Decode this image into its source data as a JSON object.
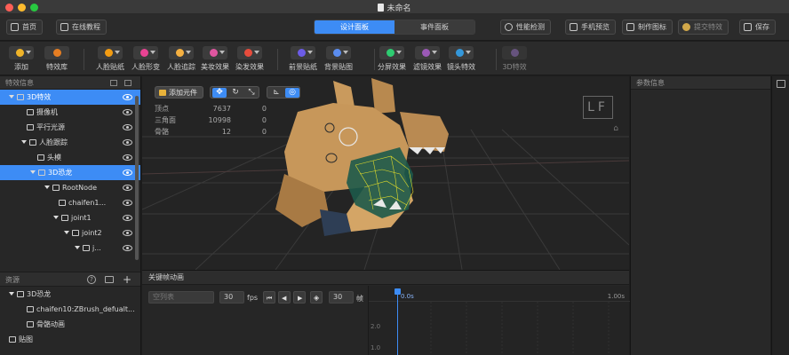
{
  "window": {
    "title": "未命名"
  },
  "topbar": {
    "home": "首页",
    "tutorial": "在线教程",
    "tabs": [
      "设计面板",
      "事件面板"
    ],
    "performance": "性能检测",
    "preview": "手机预览",
    "make_icon": "制作图标",
    "submit": "提交特效",
    "save": "保存"
  },
  "toolbar": [
    {
      "label": "添加",
      "color": "#f0b429"
    },
    {
      "label": "特效库",
      "color": "#e67e22"
    },
    {
      "label": "人脸贴纸",
      "color": "#f39c12"
    },
    {
      "label": "人脸形变",
      "color": "#e84393"
    },
    {
      "label": "人脸追踪",
      "color": "#f5b041"
    },
    {
      "label": "美妆效果",
      "color": "#e056a0"
    },
    {
      "label": "染发效果",
      "color": "#e74c3c"
    },
    {
      "label": "前景贴纸",
      "color": "#6c5ce7"
    },
    {
      "label": "背景贴图",
      "color": "#5b8def"
    },
    {
      "label": "分屏效果",
      "color": "#2ecc71"
    },
    {
      "label": "滤镜效果",
      "color": "#9b59b6"
    },
    {
      "label": "镜头特效",
      "color": "#3498db"
    },
    {
      "label": "3D特效",
      "color": "#8e6fb5"
    }
  ],
  "effects_panel": {
    "title": "特效信息",
    "items": [
      {
        "label": "3D特效"
      },
      {
        "label": "摄像机"
      },
      {
        "label": "平行光源"
      },
      {
        "label": "人脸跟踪"
      },
      {
        "label": "头模"
      },
      {
        "label": "3D恐龙"
      },
      {
        "label": "RootNode"
      },
      {
        "label": "chaifen1..."
      },
      {
        "label": "joint1"
      },
      {
        "label": "joint2"
      },
      {
        "label": "j..."
      }
    ]
  },
  "resources_panel": {
    "title": "资源",
    "items": [
      {
        "label": "3D恐龙"
      },
      {
        "label": "chaifen10:ZBrush_defualt..."
      },
      {
        "label": "骨骼动画"
      },
      {
        "label": "贴图"
      }
    ]
  },
  "viewport": {
    "add_element": "添加元件",
    "stats": [
      {
        "label": "顶点",
        "value": "7637",
        "extra": "0"
      },
      {
        "label": "三角面",
        "value": "10998",
        "extra": "0"
      },
      {
        "label": "骨骼",
        "value": "12",
        "extra": "0"
      }
    ],
    "logo": "LF"
  },
  "timeline": {
    "title": "关键帧动画",
    "name_placeholder": "空列表",
    "fps_value": "30",
    "fps_label": "fps",
    "frames_value": "30",
    "frames_label": "帧",
    "start_label": "0.0s",
    "end_label": "1.00s",
    "y_labels": [
      "2.0",
      "1.0"
    ]
  },
  "params_panel": {
    "title": "参数信息"
  }
}
